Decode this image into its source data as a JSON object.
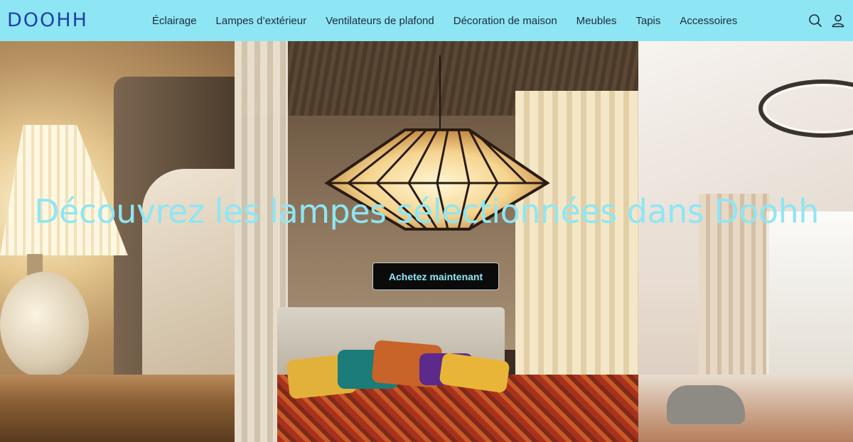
{
  "header": {
    "logo": "DOOHH",
    "nav": [
      {
        "label": "Éclairage"
      },
      {
        "label": "Lampes d’extérieur"
      },
      {
        "label": "Ventilateurs de plafond"
      },
      {
        "label": "Décoration de maison"
      },
      {
        "label": "Meubles"
      },
      {
        "label": "Tapis"
      },
      {
        "label": "Accessoires"
      }
    ],
    "icons": [
      "search-icon",
      "account-icon"
    ]
  },
  "hero": {
    "title": "Découvrez les lampes sélectionnées dans Doohh",
    "cta_label": "Achetez maintenant"
  },
  "colors": {
    "header_bg": "#8ee6f4",
    "logo": "#1f3fae",
    "accent_text": "#8ee6f4",
    "cta_bg": "#0b0b0b"
  }
}
